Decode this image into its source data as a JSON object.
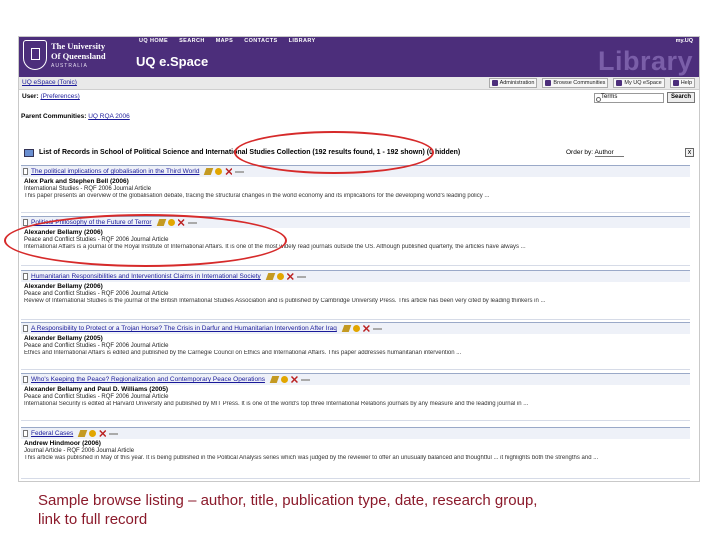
{
  "header": {
    "university": "The University\nOf Queensland",
    "country": "AUSTRALIA",
    "nav": [
      "UQ HOME",
      "SEARCH",
      "MAPS",
      "CONTACTS",
      "LIBRARY"
    ],
    "myuq": "my.UQ",
    "app_title": "UQ e.Space",
    "library_word": "Library",
    "brand_color": "#4c2e7b"
  },
  "toolbar": {
    "breadcrumb": "UQ eSpace (Tonic)",
    "tools": [
      "Administration",
      "Browse Communities",
      "My UQ eSpace",
      "Help"
    ]
  },
  "user": {
    "label": "User:",
    "prefs": "(Preferences)"
  },
  "search": {
    "value": "Terms",
    "button": "Search"
  },
  "parent": {
    "label": "Parent Communities:",
    "link": "UQ RQA 2006"
  },
  "list": {
    "header": "List of Records in School of Political Science and International Studies Collection (192 results found, 1 - 192 shown) (0 hidden)",
    "order_label": "Order by:",
    "order_value": "Author",
    "close": "x"
  },
  "records": [
    {
      "title": "The political implications of globalisation in the Third World",
      "authors": "Alex Park and Stephen Bell (2006)",
      "journal": "International Studies - RQF 2006 Journal Article",
      "abstract": "This paper presents an overview of the globalisation debate, tracing the structural changes in the world economy and its implications for the developing world's leading policy ..."
    },
    {
      "title": "Political Philosophy of the Future of Terror",
      "authors": "Alexander Bellamy (2006)",
      "journal": "Peace and Conflict Studies - RQF 2006 Journal Article",
      "abstract": "International Affairs is a journal of the Royal Institute of International Affairs. It is one of the most widely read journals outside the US. Although published quarterly, the articles have always ..."
    },
    {
      "title": "Humanitarian Responsibilities and Interventionist Claims in International Society",
      "authors": "Alexander Bellamy (2006)",
      "journal": "Peace and Conflict Studies - RQF 2006 Journal Article",
      "abstract": "Review of International Studies is the journal of the British International Studies Association and is published by Cambridge University Press. This article has been very cited by leading thinkers in ..."
    },
    {
      "title": "A Responsibility to Protect or a Trojan Horse? The Crisis in Darfur and Humanitarian Intervention After Iraq",
      "authors": "Alexander Bellamy (2005)",
      "journal": "Peace and Conflict Studies - RQF 2006 Journal Article",
      "abstract": "Ethics and International Affairs is edited and published by the Carnegie Council on Ethics and International Affairs. This paper addresses humanitarian intervention ..."
    },
    {
      "title": "Who's Keeping the Peace? Regionalization and Contemporary Peace Operations",
      "authors": "Alexander Bellamy and Paul D. Williams (2005)",
      "journal": "Peace and Conflict Studies - RQF 2006 Journal Article",
      "abstract": "International Security is edited at Harvard University and published by MIT Press. It is one of the world's top three International Relations journals by any measure and the leading journal in ..."
    },
    {
      "title": "Federal Cases",
      "authors": "Andrew Hindmoor (2006)",
      "journal": "Journal Article - RQF 2006 Journal Article",
      "abstract": "This article was published in May of this year. It is being published in the Political Analysis series which was judged by the reviewer to offer an unusually balanced and thoughtful ... it highlights both the strengths and ..."
    }
  ],
  "caption": "Sample browse listing – author, title, publication type, date, research group,\nlink to full record",
  "caption_color": "#8b1a2b",
  "annotation_color": "#d62a2a"
}
